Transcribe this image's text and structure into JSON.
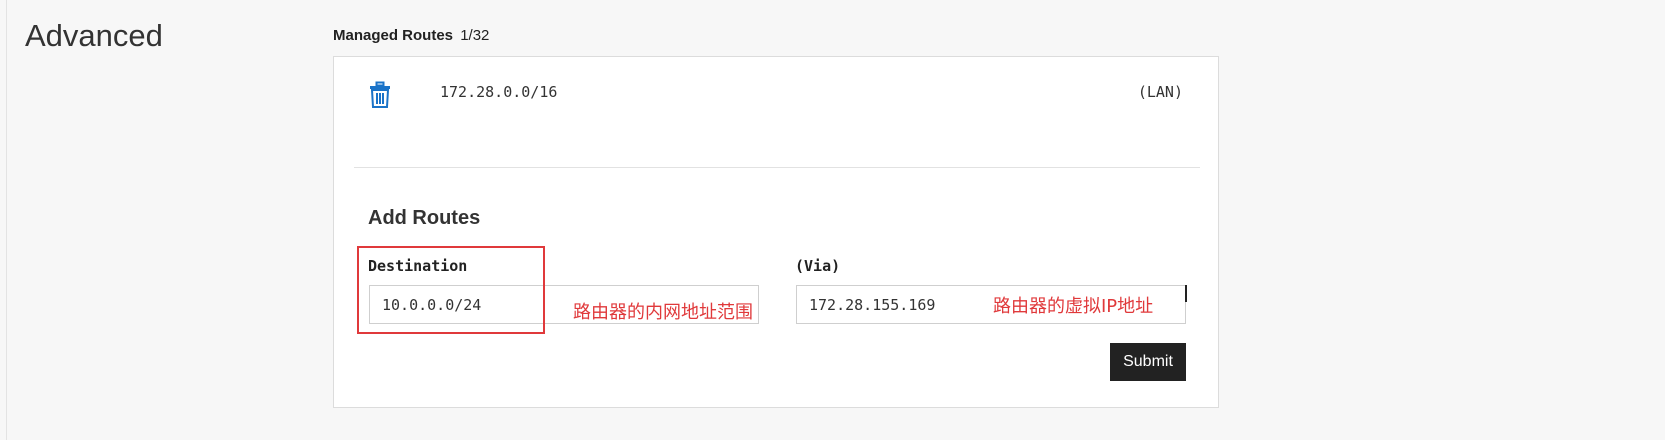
{
  "section": {
    "title": "Advanced"
  },
  "managed_routes": {
    "label": "Managed Routes",
    "count": "1/32",
    "routes": [
      {
        "destination": "172.28.0.0/16",
        "tag": "(LAN)",
        "delete_icon": "trash-icon"
      }
    ]
  },
  "add_routes": {
    "heading": "Add Routes",
    "destination": {
      "label": "Destination",
      "value": "10.0.0.0/24",
      "placeholder": ""
    },
    "via": {
      "label": "(Via)",
      "value": "172.28.155.169",
      "placeholder": ""
    },
    "submit_label": "Submit"
  },
  "annotations": {
    "destination_note": "路由器的内网地址范围",
    "via_note": "路由器的虚拟IP地址"
  },
  "colors": {
    "accent": "#1a73c8",
    "annotation": "#e0393b",
    "button": "#222222",
    "background": "#f7f7f7"
  }
}
